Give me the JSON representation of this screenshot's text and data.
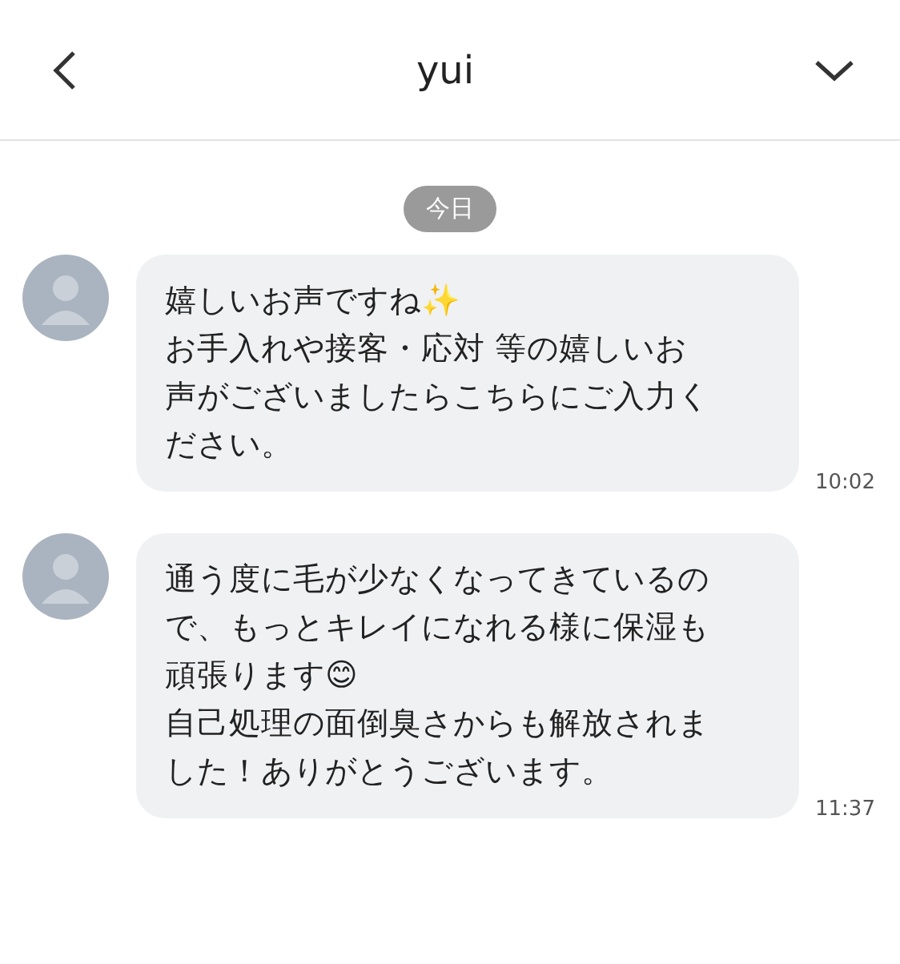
{
  "header": {
    "title": "yui"
  },
  "date_divider": "今日",
  "messages": [
    {
      "text": "嬉しいお声ですね✨\nお手入れや接客・応対 等の嬉しいお声がございましたらこちらにご入力ください。",
      "time": "10:02"
    },
    {
      "text": "通う度に毛が少なくなってきているので、もっとキレイになれる様に保湿も頑張ります😊\n自己処理の面倒臭さからも解放されました！ありがとうございます。",
      "time": "11:37"
    }
  ]
}
